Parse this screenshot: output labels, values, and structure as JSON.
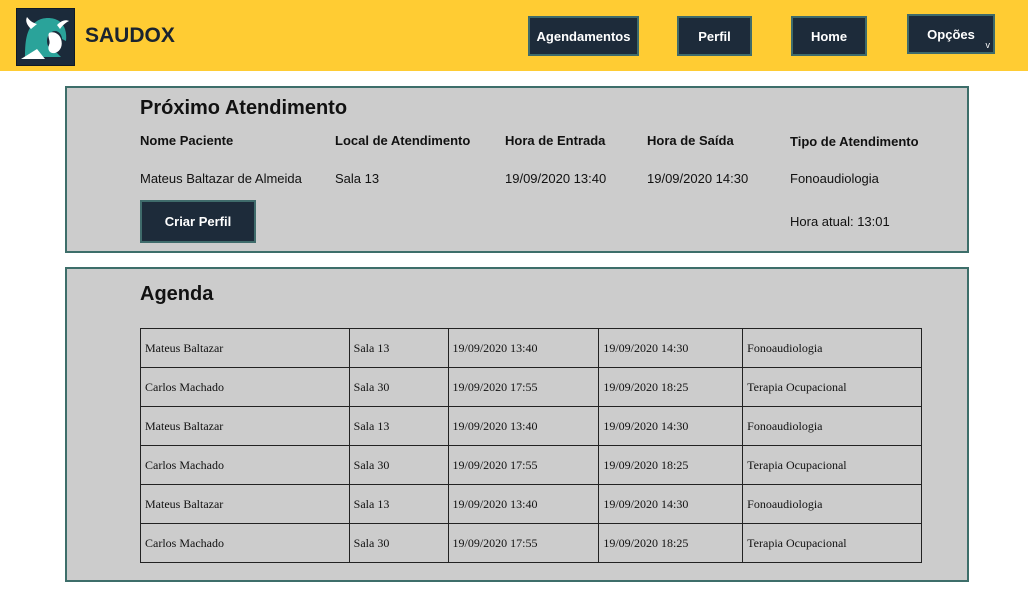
{
  "brand": {
    "name": "SAUDOX",
    "logo_icon": "bull-head-logo-icon"
  },
  "nav": [
    {
      "label": "Agendamentos"
    },
    {
      "label": "Perfil"
    },
    {
      "label": "Home"
    },
    {
      "label": "Opções",
      "caret": "v"
    }
  ],
  "next": {
    "title": "Próximo Atendimento",
    "headers": [
      "Nome Paciente",
      "Local de Atendimento",
      "Hora de Entrada",
      "Hora de Saída",
      "Tipo de Atendimento"
    ],
    "values": [
      "Mateus Baltazar de Almeida",
      "Sala 13",
      "19/09/2020 13:40",
      "19/09/2020 14:30",
      "Fonoaudiologia"
    ],
    "create_button": "Criar Perfil",
    "clock": "Hora atual: 13:01"
  },
  "agenda": {
    "title": "Agenda",
    "rows": [
      [
        "Mateus Baltazar",
        "Sala 13",
        "19/09/2020 13:40",
        "19/09/2020 14:30",
        "Fonoaudiologia"
      ],
      [
        "Carlos Machado",
        "Sala 30",
        "19/09/2020 17:55",
        "19/09/2020 18:25",
        "Terapia Ocupacional"
      ],
      [
        "Mateus Baltazar",
        "Sala 13",
        "19/09/2020 13:40",
        "19/09/2020 14:30",
        "Fonoaudiologia"
      ],
      [
        "Carlos Machado",
        "Sala 30",
        "19/09/2020 17:55",
        "19/09/2020 18:25",
        "Terapia Ocupacional"
      ],
      [
        "Mateus Baltazar",
        "Sala 13",
        "19/09/2020 13:40",
        "19/09/2020 14:30",
        "Fonoaudiologia"
      ],
      [
        "Carlos Machado",
        "Sala 30",
        "19/09/2020 17:55",
        "19/09/2020 18:25",
        "Terapia Ocupacional"
      ]
    ]
  },
  "colors": {
    "topbar": "#ffcc33",
    "button": "#1d2b3a",
    "panel": "#cccccc",
    "panel_border": "#3d6e6a"
  }
}
